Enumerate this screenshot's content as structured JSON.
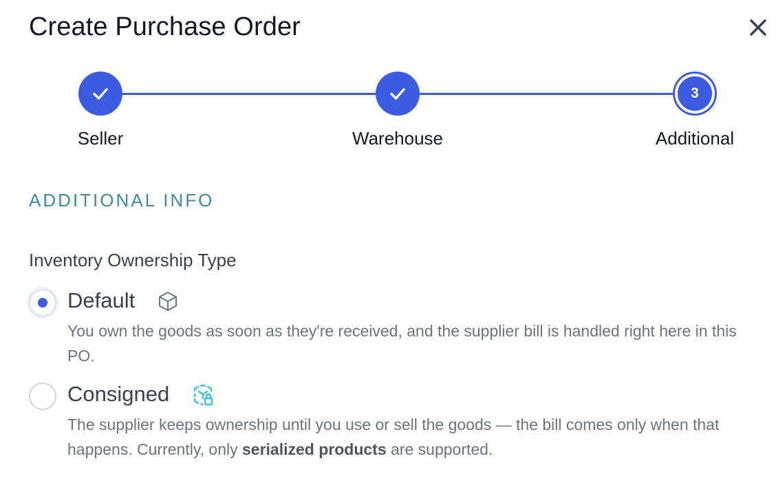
{
  "dialog": {
    "title": "Create Purchase Order",
    "close_icon": "close-icon"
  },
  "stepper": {
    "steps": [
      {
        "label": "Seller",
        "status": "complete",
        "icon": "check-icon"
      },
      {
        "label": "Warehouse",
        "status": "complete",
        "icon": "check-icon"
      },
      {
        "label": "Additional",
        "status": "current",
        "number": "3"
      }
    ],
    "accent_color": "#3b5be0"
  },
  "section": {
    "heading": "ADDITIONAL INFO",
    "heading_color": "#3d8aa8"
  },
  "ownership": {
    "label": "Inventory Ownership Type",
    "options": [
      {
        "title": "Default",
        "icon": "box-icon",
        "selected": true,
        "description": "You own the goods as soon as they're received, and the supplier bill is handled right here in this PO."
      },
      {
        "title": "Consigned",
        "icon": "consigned-icon",
        "selected": false,
        "description_pre": "The supplier keeps ownership until you use or sell the goods — the bill comes only when that happens. Currently, only ",
        "description_bold": "serialized products",
        "description_post": " are supported."
      }
    ]
  }
}
